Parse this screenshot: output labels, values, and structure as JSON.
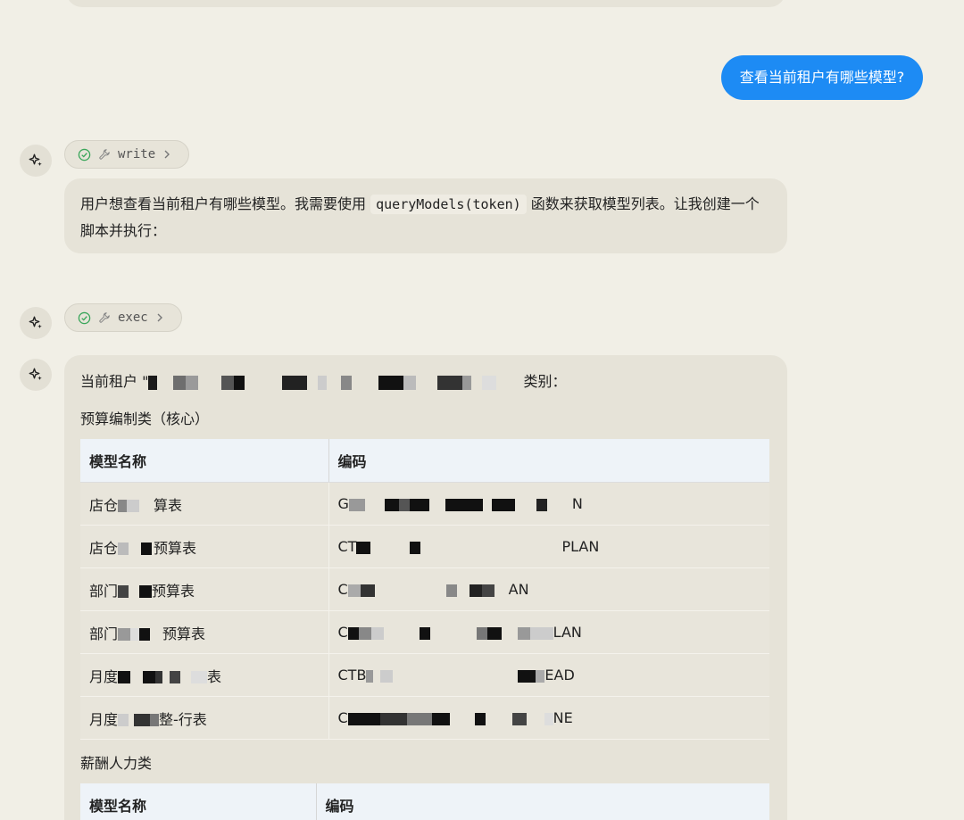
{
  "user_message": "查看当前租户有哪些模型?",
  "tools": [
    {
      "name": "write"
    },
    {
      "name": "exec"
    }
  ],
  "thinking": {
    "pre": "用户想查看当前租户有哪些模型。我需要使用",
    "code": "queryModels(token)",
    "post": "函数来获取模型列表。让我创建一个脚本并执行："
  },
  "result": {
    "intro_prefix": "当前租户 \"",
    "intro_suffix": "类别：",
    "section1_title": "预算编制类（核心）",
    "section2_title": "薪酬人力类",
    "columns": [
      "模型名称",
      "编码"
    ],
    "rows": [
      {
        "name_a": "店仓",
        "name_b": "算表",
        "code_a": "G",
        "code_b": "N"
      },
      {
        "name_a": "店仓",
        "name_b": "预算表",
        "code_a": "CT",
        "code_b": "PLAN"
      },
      {
        "name_a": "部门",
        "name_b": "预算表",
        "code_a": "C",
        "code_b": "AN"
      },
      {
        "name_a": "部门",
        "name_b": "预算表",
        "code_a": "C",
        "code_b": "LAN"
      },
      {
        "name_a": "月度",
        "name_b": "表",
        "code_a": "CTB",
        "code_b": "EAD"
      },
      {
        "name_a": "月度",
        "name_b": "整-行表",
        "code_a": "C",
        "code_b": "NE"
      }
    ]
  }
}
